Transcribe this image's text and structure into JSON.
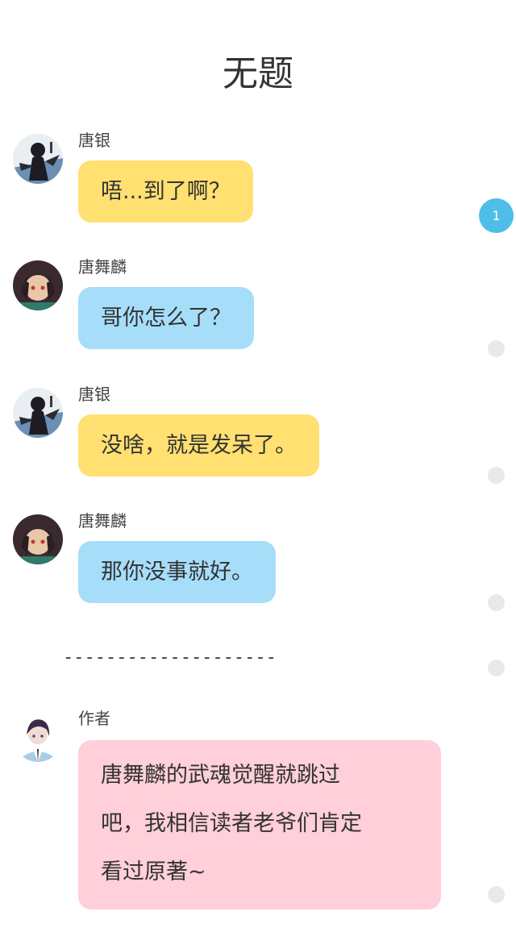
{
  "title": "无题",
  "messages": [
    {
      "sender": "唐银",
      "text": "唔...到了啊？",
      "color": "#ffe071",
      "avatar": "tangyin-avatar"
    },
    {
      "sender": "唐舞麟",
      "text": "哥你怎么了？",
      "color": "#a6defa",
      "avatar": "tangwulin-avatar"
    },
    {
      "sender": "唐银",
      "text": "没啥，就是发呆了。",
      "color": "#ffe071",
      "avatar": "tangyin-avatar"
    },
    {
      "sender": "唐舞麟",
      "text": "那你没事就好。",
      "color": "#a6defa",
      "avatar": "tangwulin-avatar"
    }
  ],
  "divider": "--------------------",
  "author_note": {
    "sender": "作者",
    "lines": [
      "唐舞麟的武魂觉醒就跳过",
      "吧，我相信读者老爷们肯定",
      "看过原著~"
    ],
    "color": "#ffcfda",
    "avatar": "author-avatar"
  },
  "rail": {
    "active_label": "1",
    "active_color": "#4ebee8",
    "inactive_color": "#e9e9e9"
  }
}
